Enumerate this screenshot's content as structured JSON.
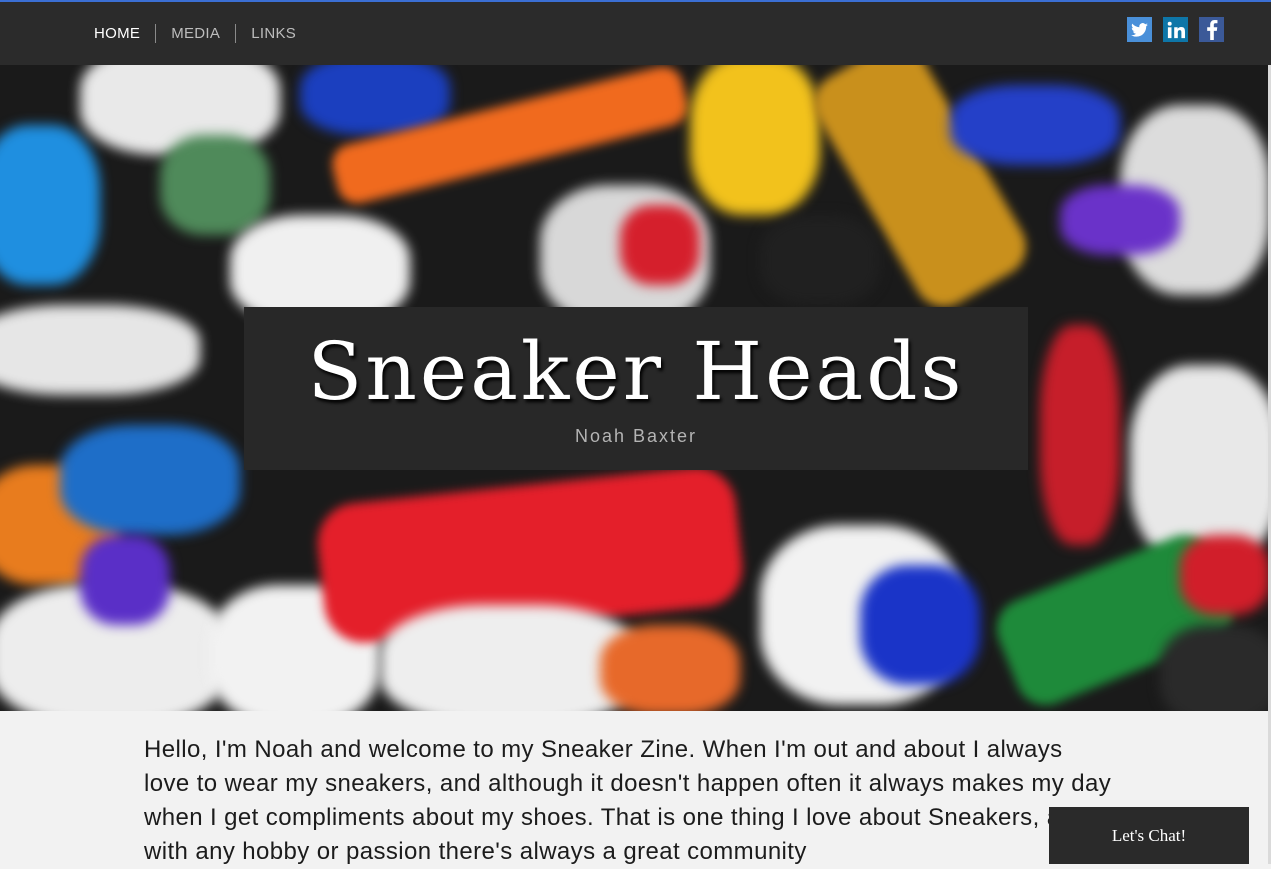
{
  "nav": {
    "items": [
      {
        "label": "HOME",
        "active": true
      },
      {
        "label": "MEDIA",
        "active": false
      },
      {
        "label": "LINKS",
        "active": false
      }
    ]
  },
  "social": [
    {
      "icon": "twitter-icon",
      "color": "#4a90d9"
    },
    {
      "icon": "linkedin-icon",
      "color": "#0e76a8"
    },
    {
      "icon": "facebook-icon",
      "color": "#3b5998"
    }
  ],
  "hero": {
    "title": "Sneaker Heads",
    "author": "Noah Baxter"
  },
  "intro": {
    "text": "Hello, I'm Noah and welcome to my Sneaker Zine. When I'm out and about I always love to wear my sneakers, and although it doesn't happen often it always makes my day when I get compliments about my shoes. That is one thing I love about Sneakers, as with any hobby or passion there's always a great community"
  },
  "chat": {
    "label": "Let's Chat!"
  },
  "colors": {
    "navbar": "#2b2b2b",
    "accent_line": "#3b6fd4",
    "title_box": "#282828"
  }
}
